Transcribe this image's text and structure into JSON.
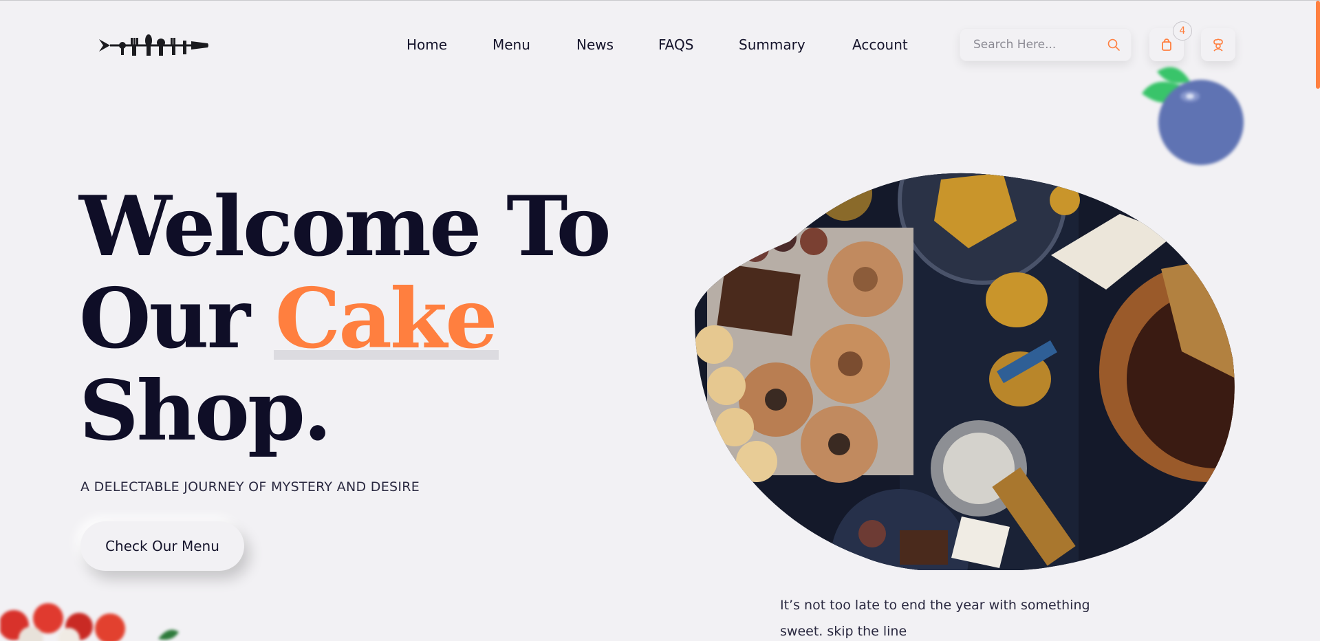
{
  "brand": {
    "logo_icon": "cutlery-logo-icon"
  },
  "nav": {
    "items": [
      {
        "label": "Home"
      },
      {
        "label": "Menu"
      },
      {
        "label": "News"
      },
      {
        "label": "FAQS"
      },
      {
        "label": "Summary"
      },
      {
        "label": "Account"
      }
    ]
  },
  "search": {
    "placeholder": "Search Here...",
    "value": "",
    "icon": "search-icon"
  },
  "cart": {
    "count": "4",
    "icon": "shopping-bag-icon"
  },
  "user": {
    "icon": "chef-user-icon"
  },
  "hero": {
    "title_line1": "Welcome To",
    "title_line2_prefix": "Our ",
    "title_accent": "Cake",
    "title_line3": "Shop.",
    "subtitle": "A DELECTABLE JOURNEY OF MYSTERY AND DESIRE",
    "cta_label": "Check Our Menu",
    "caption": "It’s not too late to end the year with something sweet. skip the line"
  },
  "colors": {
    "accent": "#ff7f3f",
    "heading": "#0f0e27",
    "background": "#f2f1f4",
    "blueberry": "#5f73b3",
    "leaf": "#39c46a"
  }
}
